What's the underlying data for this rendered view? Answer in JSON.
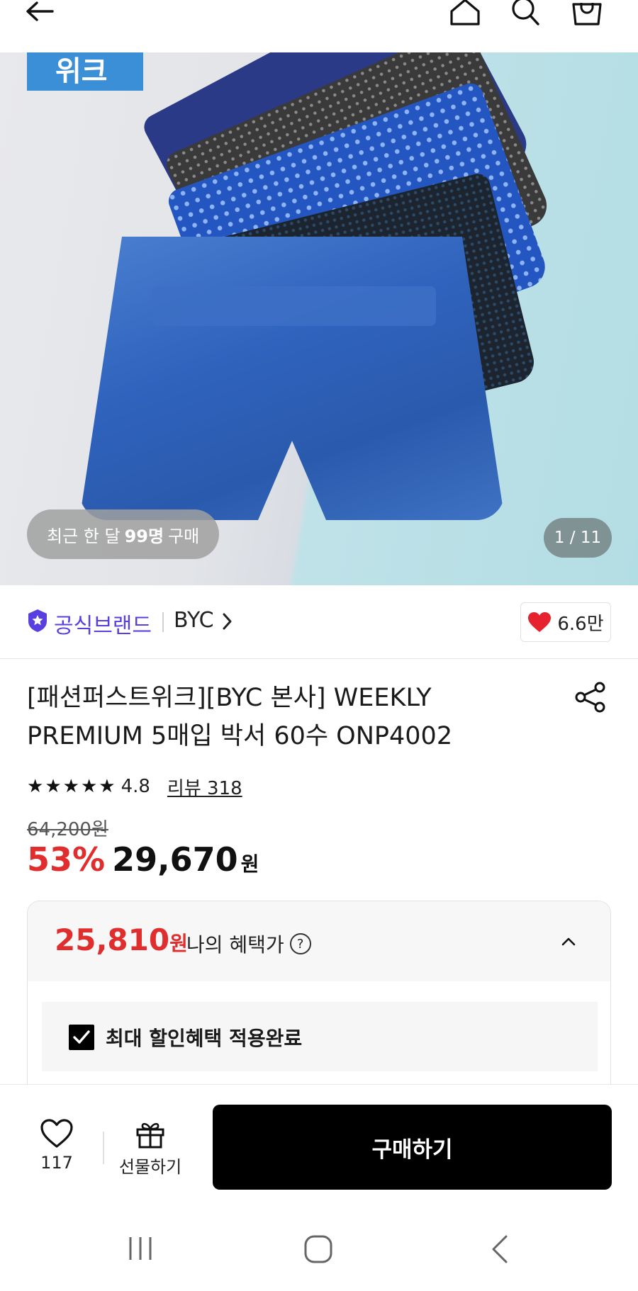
{
  "header": {
    "back_icon": "arrow-left-icon",
    "home_icon": "home-icon",
    "search_icon": "search-icon",
    "cart_icon": "shopping-bag-icon"
  },
  "hero": {
    "tag_text": "위크",
    "recent_purchase": {
      "prefix": "최근 한 달",
      "count": "99명",
      "suffix": "구매"
    },
    "image_counter": "1 / 11"
  },
  "brand": {
    "official_label": "공식브랜드",
    "name": "BYC",
    "likes": "6.6만",
    "colors": {
      "official": "#5a3fe0",
      "heart": "#e5222e"
    }
  },
  "product": {
    "title_line1": "[패션퍼스트위크][BYC 본사] WEEKLY",
    "title_line2": "PREMIUM 5매입 박서 60수 ONP4002",
    "rating": "4.8",
    "review_label": "리뷰 318",
    "stars": 5,
    "original_price": "64,200원",
    "discount_rate": "53%",
    "sale_price": "29,670",
    "currency": "원"
  },
  "benefit": {
    "price": "25,810",
    "currency": "원",
    "label": "나의 혜택가",
    "help_icon": "?",
    "applied_text": "최대 할인혜택 적용완료",
    "checked": true,
    "accent": "#e02e2e"
  },
  "bottom_bar": {
    "wish_count": "117",
    "gift_label": "선물하기",
    "buy_label": "구매하기"
  },
  "system_nav": {
    "recent_apps_icon": "recent-apps-icon",
    "home_icon": "system-home-icon",
    "back_icon": "system-back-icon"
  }
}
